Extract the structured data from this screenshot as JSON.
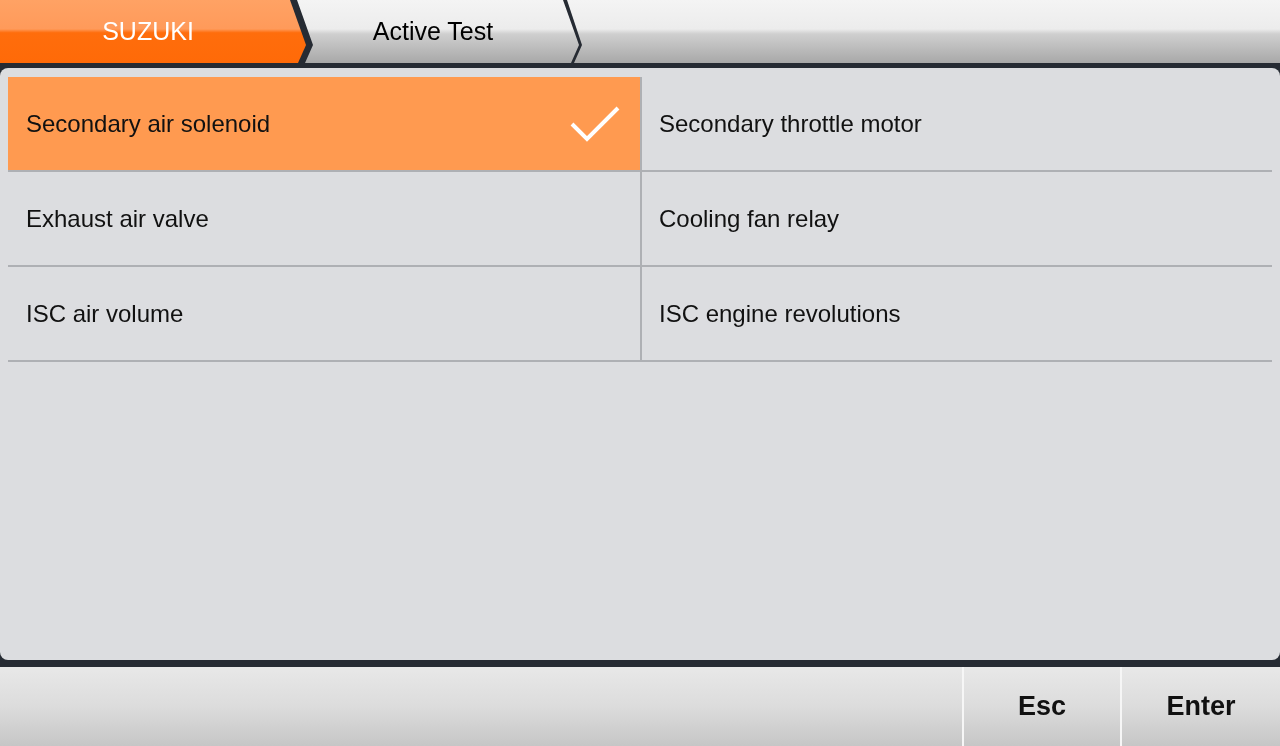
{
  "breadcrumbs": [
    {
      "label": "SUZUKI",
      "selected": true
    },
    {
      "label": "Active Test",
      "selected": false
    }
  ],
  "items": [
    {
      "label": "Secondary air solenoid",
      "selected": true
    },
    {
      "label": "Secondary throttle motor",
      "selected": false
    },
    {
      "label": "Exhaust air valve",
      "selected": false
    },
    {
      "label": "Cooling fan relay",
      "selected": false
    },
    {
      "label": "ISC air volume",
      "selected": false
    },
    {
      "label": "ISC engine revolutions",
      "selected": false
    }
  ],
  "buttons": [
    "Esc",
    "Enter"
  ]
}
